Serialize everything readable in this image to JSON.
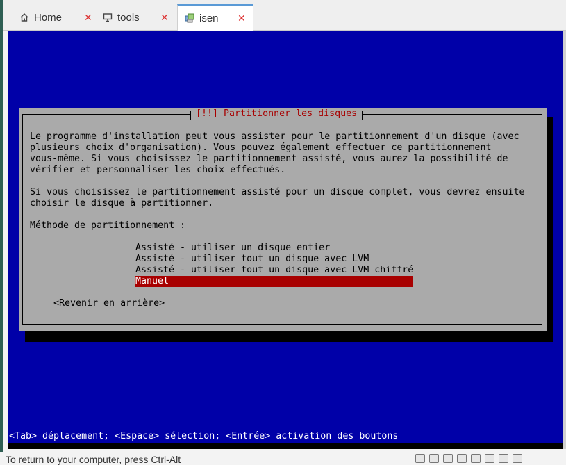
{
  "tabs": [
    {
      "label": "Home",
      "icon": "home-icon"
    },
    {
      "label": "tools",
      "icon": "monitor-icon"
    },
    {
      "label": "isen",
      "icon": "vm-icon"
    }
  ],
  "dialog": {
    "title": "[!!] Partitionner les disques",
    "body": "Le programme d'installation peut vous assister pour le partitionnement d'un disque (avec\nplusieurs choix d'organisation). Vous pouvez également effectuer ce partitionnement\nvous-même. Si vous choisissez le partitionnement assisté, vous aurez la possibilité de\nvérifier et personnaliser les choix effectués.\n\nSi vous choisissez le partitionnement assisté pour un disque complet, vous devrez ensuite\nchoisir le disque à partitionner.\n\nMéthode de partitionnement :",
    "options": [
      "Assisté - utiliser un disque entier",
      "Assisté - utiliser tout un disque avec LVM",
      "Assisté - utiliser tout un disque avec LVM chiffré",
      "Manuel"
    ],
    "selected_index": 3,
    "back_button": "<Revenir en arrière>"
  },
  "help_line": "<Tab> déplacement; <Espace> sélection; <Entrée> activation des boutons",
  "status_text": "To return to your computer, press Ctrl-Alt",
  "colors": {
    "screen_bg": "#0000a8",
    "dialog_bg": "#aaaaaa",
    "title_color": "#a80000",
    "selection_bg": "#a80000"
  }
}
